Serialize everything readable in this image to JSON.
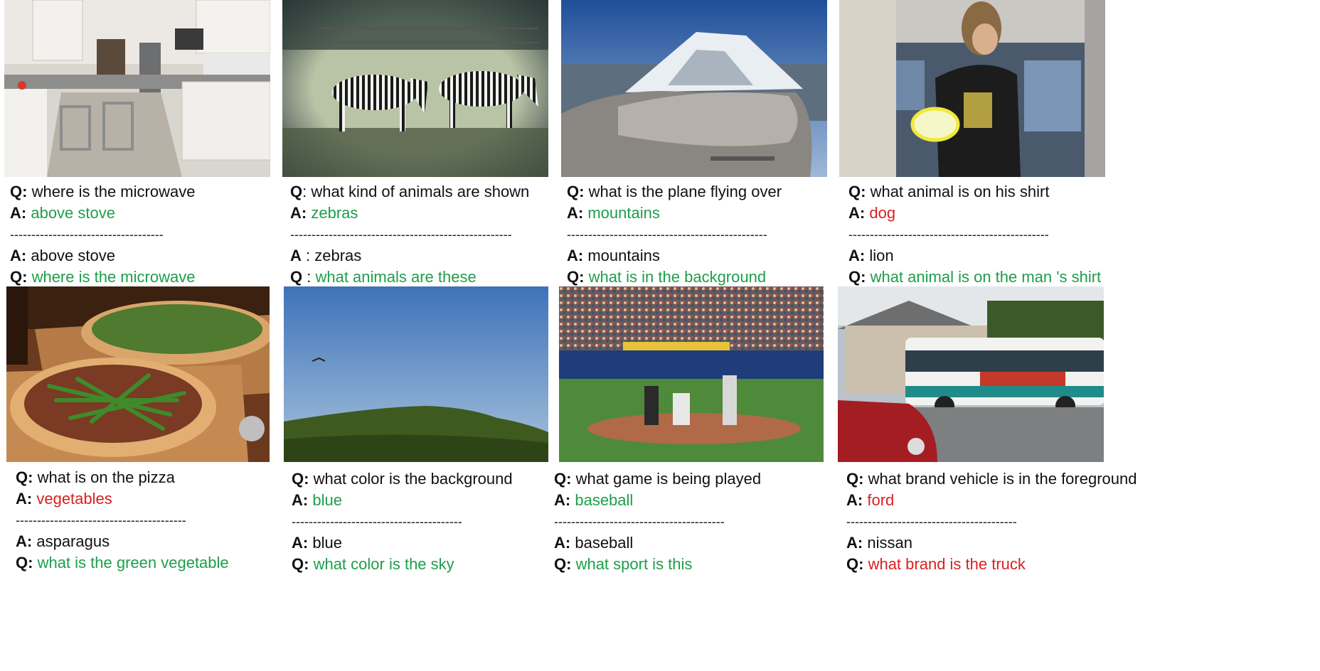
{
  "colors": {
    "correct": "#1e9e4a",
    "wrong": "#d9201f"
  },
  "examples": [
    {
      "image": "kitchen",
      "q_label": "Q:",
      "a_label": "A:",
      "question": "where is the microwave",
      "answer": "above stove",
      "answer_status": "correct",
      "sep": "------------------------------------",
      "given_answer": "above stove",
      "gen_question": "where is the microwave",
      "gen_status": "correct"
    },
    {
      "image": "zebras",
      "q_label": "Q",
      "q_sep": ":",
      "a_label": "A:",
      "question": "what kind of animals are shown",
      "answer": "zebras",
      "answer_status": "correct",
      "sep": "----------------------------------------------------",
      "given_answer": "zebras",
      "gen_question": "what animals are these",
      "gen_status": "correct"
    },
    {
      "image": "mountain",
      "q_label": "Q:",
      "a_label": "A:",
      "question": "what is the plane flying over",
      "answer": "mountains",
      "answer_status": "correct",
      "sep": "-----------------------------------------------",
      "given_answer": "mountains",
      "gen_question": "what is in the background",
      "gen_status": "correct"
    },
    {
      "image": "frisbee",
      "q_label": "Q:",
      "a_label": "A:",
      "question": "what animal is on his shirt",
      "answer": "dog",
      "answer_status": "wrong",
      "sep": "-----------------------------------------------",
      "given_answer": "lion",
      "gen_question": "what animal is on the man 's shirt",
      "gen_status": "correct"
    },
    {
      "image": "pizza",
      "q_label": "Q:",
      "a_label": "A:",
      "question": "what is on the pizza",
      "answer": "vegetables",
      "answer_status": "wrong",
      "sep": "----------------------------------------",
      "given_answer": "asparagus",
      "gen_question": "what is the green vegetable",
      "gen_status": "correct"
    },
    {
      "image": "sky",
      "q_label": "Q:",
      "a_label": "A:",
      "question": "what color is the background",
      "answer": "blue",
      "answer_status": "correct",
      "sep": "----------------------------------------",
      "given_answer": "blue",
      "gen_question": "what color is the sky",
      "gen_status": "correct"
    },
    {
      "image": "baseball",
      "q_label": "Q:",
      "a_label": "A:",
      "question": "what game is being played",
      "answer": "baseball",
      "answer_status": "correct",
      "sep": "----------------------------------------",
      "given_answer": "baseball",
      "gen_question": "what sport is this",
      "gen_status": "correct"
    },
    {
      "image": "bus",
      "q_label": "Q:",
      "a_label": "A:",
      "question": "what brand vehicle is in the foreground",
      "answer": "ford",
      "answer_status": "wrong",
      "sep": "----------------------------------------",
      "given_answer": "nissan",
      "gen_question": "what brand is the truck",
      "gen_status": "wrong"
    }
  ]
}
